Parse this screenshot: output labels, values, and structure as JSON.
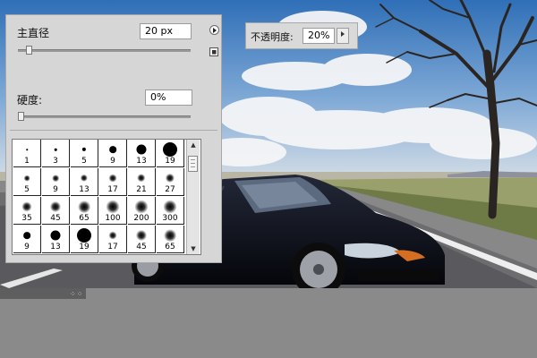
{
  "brush_panel": {
    "master_diameter_label": "主直径",
    "master_diameter_value": "20 px",
    "master_diameter_level": 0.05,
    "hardness_label": "硬度:",
    "hardness_value": "0%",
    "hardness_level": 0.0,
    "presets": [
      {
        "size": "1",
        "type": "hard"
      },
      {
        "size": "3",
        "type": "hard"
      },
      {
        "size": "5",
        "type": "hard"
      },
      {
        "size": "9",
        "type": "hard"
      },
      {
        "size": "13",
        "type": "hard"
      },
      {
        "size": "19",
        "type": "hard"
      },
      {
        "size": "5",
        "type": "soft"
      },
      {
        "size": "9",
        "type": "soft"
      },
      {
        "size": "13",
        "type": "soft"
      },
      {
        "size": "17",
        "type": "soft"
      },
      {
        "size": "21",
        "type": "soft"
      },
      {
        "size": "27",
        "type": "soft"
      },
      {
        "size": "35",
        "type": "soft"
      },
      {
        "size": "45",
        "type": "soft"
      },
      {
        "size": "65",
        "type": "soft"
      },
      {
        "size": "100",
        "type": "soft"
      },
      {
        "size": "200",
        "type": "soft"
      },
      {
        "size": "300",
        "type": "soft"
      },
      {
        "size": "9",
        "type": "hard"
      },
      {
        "size": "13",
        "type": "hard"
      },
      {
        "size": "19",
        "type": "hard"
      },
      {
        "size": "17",
        "type": "soft"
      },
      {
        "size": "45",
        "type": "soft"
      },
      {
        "size": "65",
        "type": "soft"
      }
    ]
  },
  "opacity_panel": {
    "label": "不透明度:",
    "value": "20%"
  },
  "icons": {
    "menu": "flyout-menu-icon",
    "save": "new-preset-icon",
    "dropdown": "dropdown-arrow-icon"
  }
}
